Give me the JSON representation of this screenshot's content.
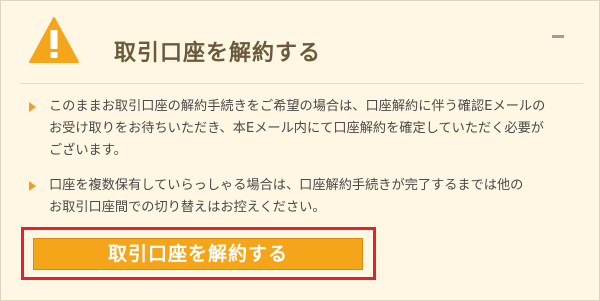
{
  "header": {
    "title": "取引口座を解約する",
    "icon": "warning-icon",
    "minimize_icon": "minimize-icon"
  },
  "notices": [
    {
      "lines": [
        "このままお取引口座の解約手続きをご希望の場合は、口座解約に伴う確認Eメールの",
        "お受け取りをお待ちいただき、本Eメール内にて口座解約を確定していただく必要が",
        "ございます。"
      ]
    },
    {
      "lines": [
        "口座を複数保有していらっしゃる場合は、口座解約手続きが完了するまでは他の",
        "お取引口座間での切り替えはお控えください。"
      ]
    }
  ],
  "action": {
    "label": "取引口座を解約する"
  },
  "colors": {
    "panel_bg": "#fff7e3",
    "accent_orange": "#f5a51a",
    "highlight_red": "#e8202a",
    "title_text": "#6b5a3a"
  }
}
